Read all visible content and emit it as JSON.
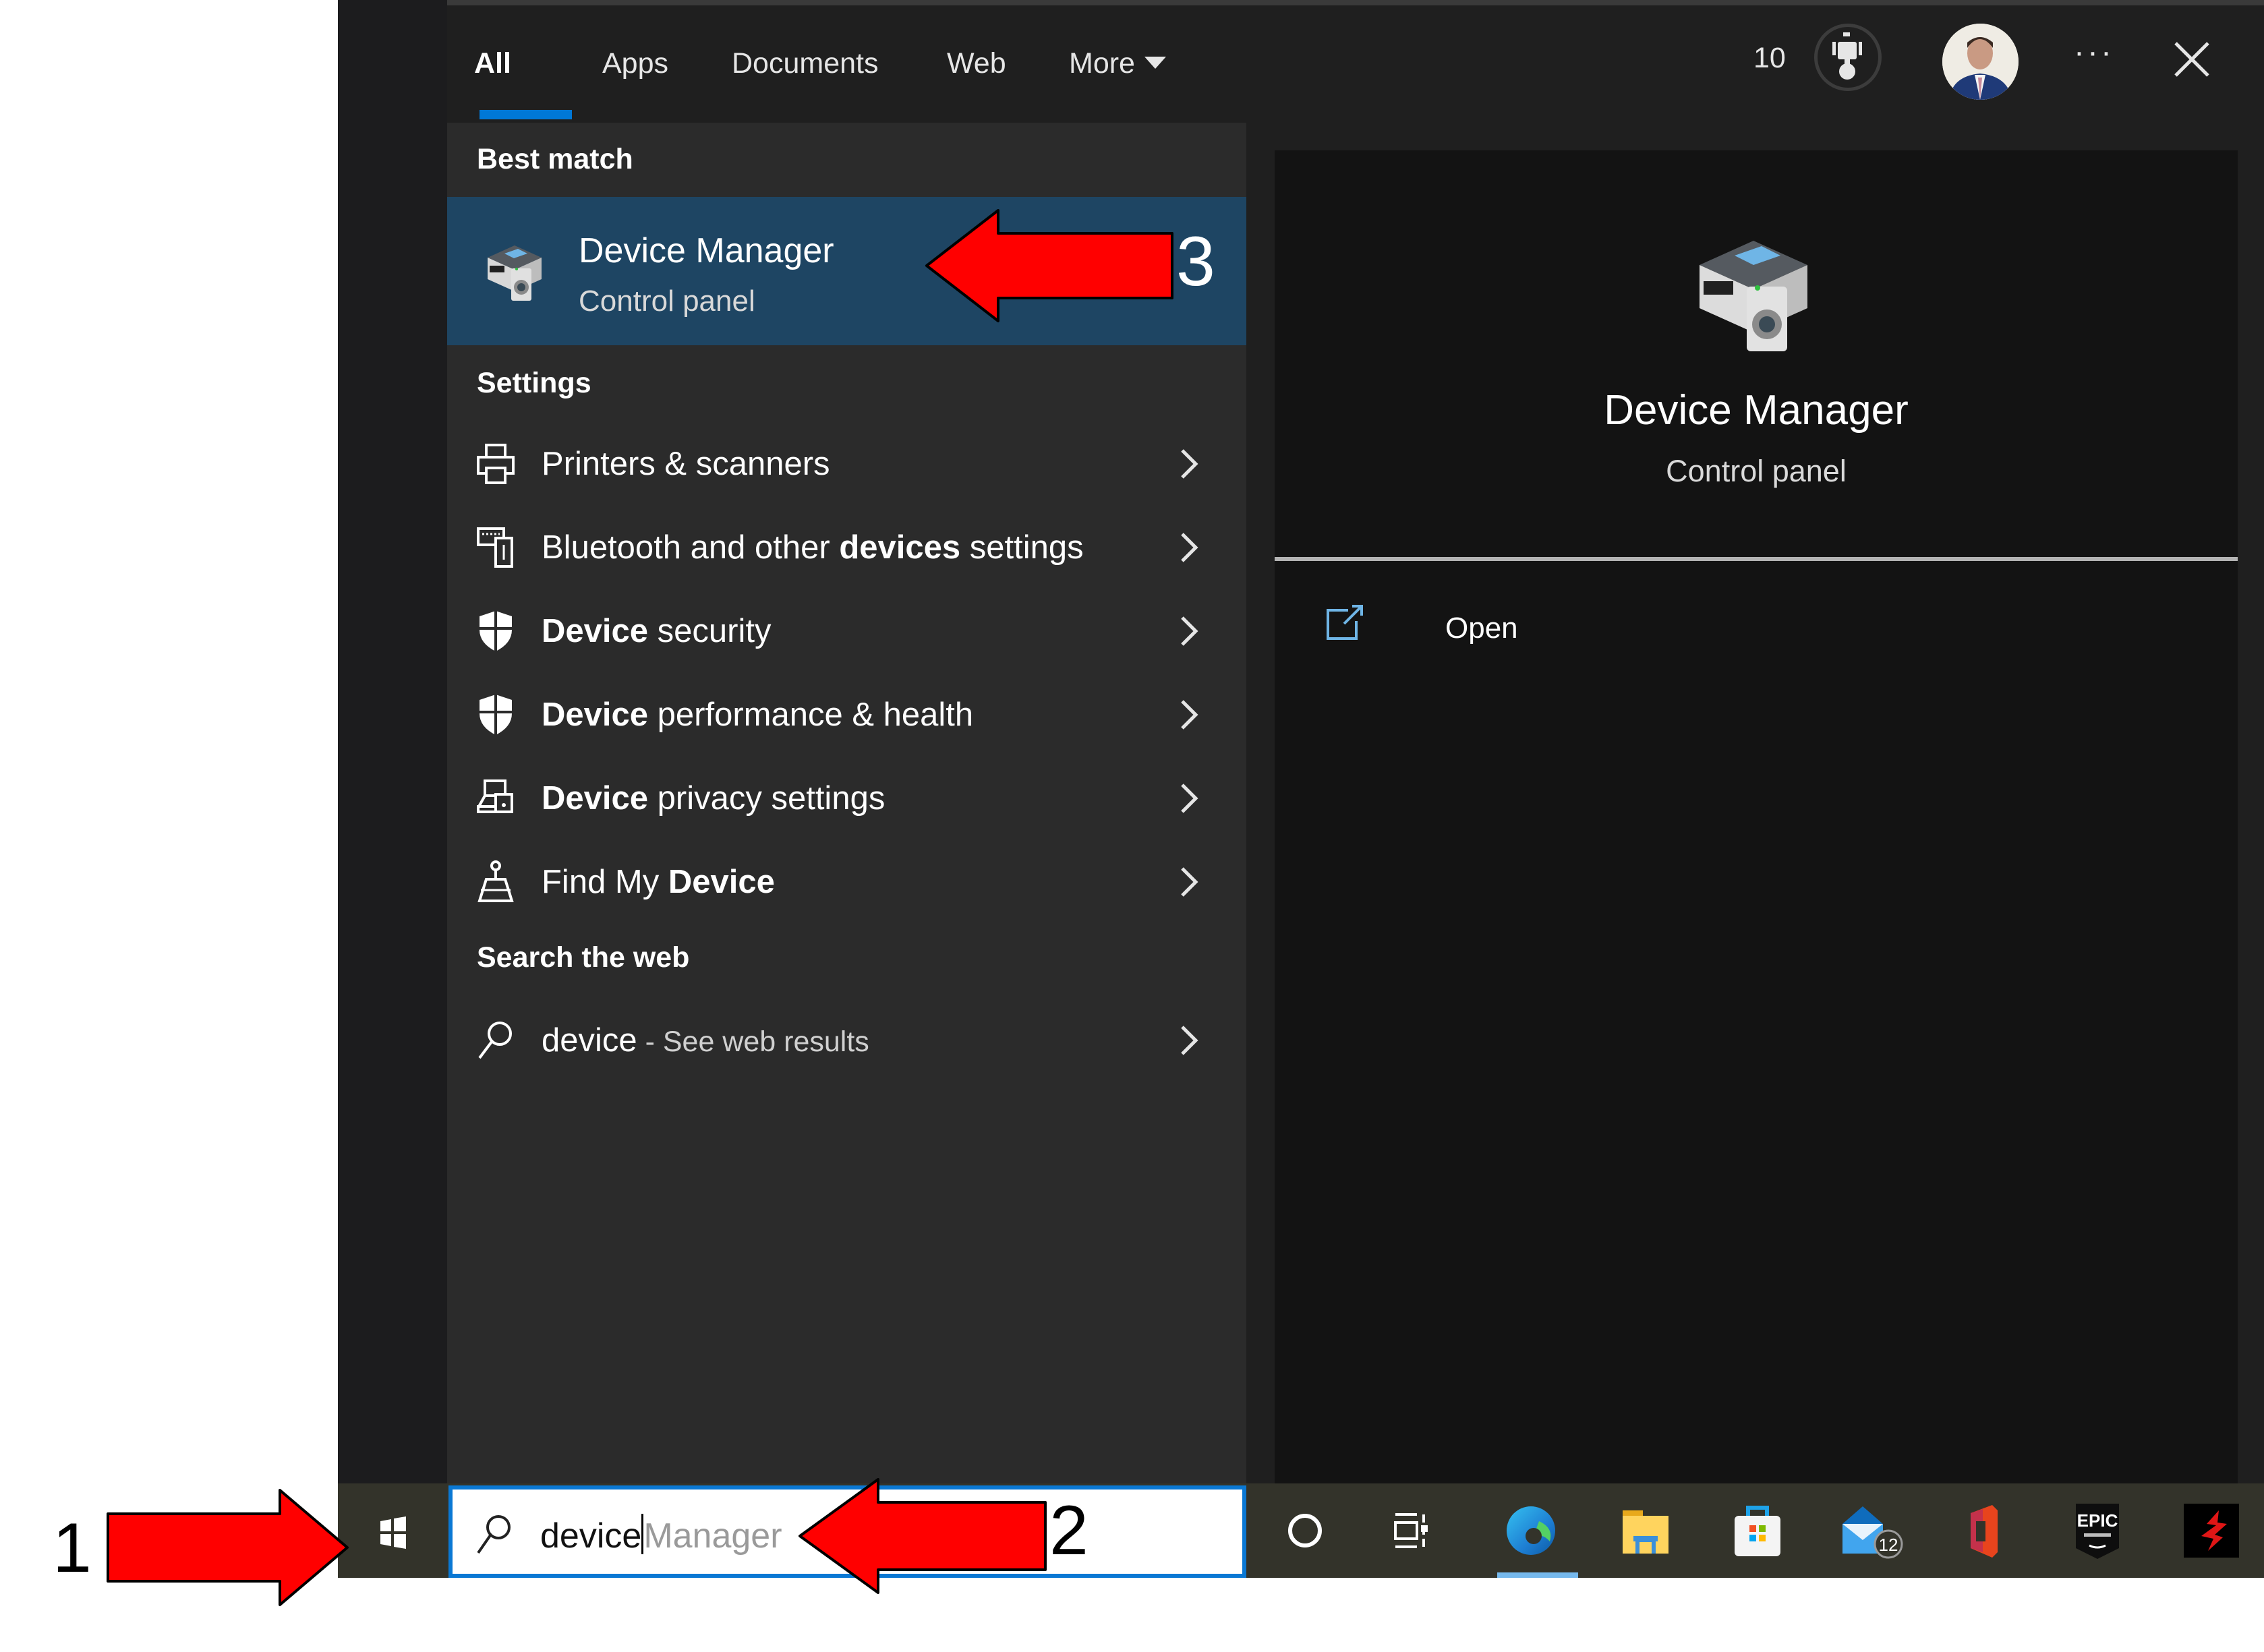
{
  "tabs": [
    {
      "label": "All",
      "active": true
    },
    {
      "label": "Apps",
      "active": false
    },
    {
      "label": "Documents",
      "active": false
    },
    {
      "label": "Web",
      "active": false
    },
    {
      "label": "More",
      "active": false
    }
  ],
  "header": {
    "points": "10",
    "more_label": "···"
  },
  "results": {
    "best_match_label": "Best match",
    "best_match": {
      "title": "Device Manager",
      "subtitle": "Control panel"
    },
    "settings_label": "Settings",
    "settings": [
      {
        "icon": "printer-icon",
        "pre": "Printers & scanners",
        "bold": "",
        "post": ""
      },
      {
        "icon": "bluetooth-devices-icon",
        "pre": "Bluetooth and other ",
        "bold": "devices",
        "post": " settings"
      },
      {
        "icon": "shield-icon",
        "pre": "",
        "bold": "Device",
        "post": " security"
      },
      {
        "icon": "shield-icon",
        "pre": "",
        "bold": "Device",
        "post": " performance & health"
      },
      {
        "icon": "device-privacy-icon",
        "pre": "",
        "bold": "Device",
        "post": " privacy settings"
      },
      {
        "icon": "find-device-icon",
        "pre": "Find My ",
        "bold": "Device",
        "post": ""
      }
    ],
    "web_label": "Search the web",
    "web": {
      "query": "device",
      "suffix": " - See web results"
    }
  },
  "preview": {
    "title": "Device Manager",
    "subtitle": "Control panel",
    "actions": [
      {
        "label": "Open",
        "icon": "open-external-icon"
      }
    ]
  },
  "taskbar": {
    "search_typed": "device",
    "search_suggestion": "Manager",
    "apps": [
      {
        "name": "cortana-icon"
      },
      {
        "name": "task-view-icon"
      },
      {
        "name": "edge-icon",
        "active": true
      },
      {
        "name": "file-explorer-icon"
      },
      {
        "name": "microsoft-store-icon"
      },
      {
        "name": "mail-icon",
        "badge": "12"
      },
      {
        "name": "office-icon"
      },
      {
        "name": "epic-games-icon",
        "text": "EPIC"
      },
      {
        "name": "witcher-icon"
      }
    ]
  },
  "annotations": [
    {
      "number": "1",
      "target": "start-button"
    },
    {
      "number": "2",
      "target": "search-box"
    },
    {
      "number": "3",
      "target": "best-match-device-manager"
    }
  ],
  "colors": {
    "accent": "#0078d7",
    "selected_row": "#1e4563",
    "list_bg": "#2b2b2b",
    "preview_bg": "#131313",
    "taskbar_bg": "#33332a",
    "annotation_red": "#ff0000"
  }
}
